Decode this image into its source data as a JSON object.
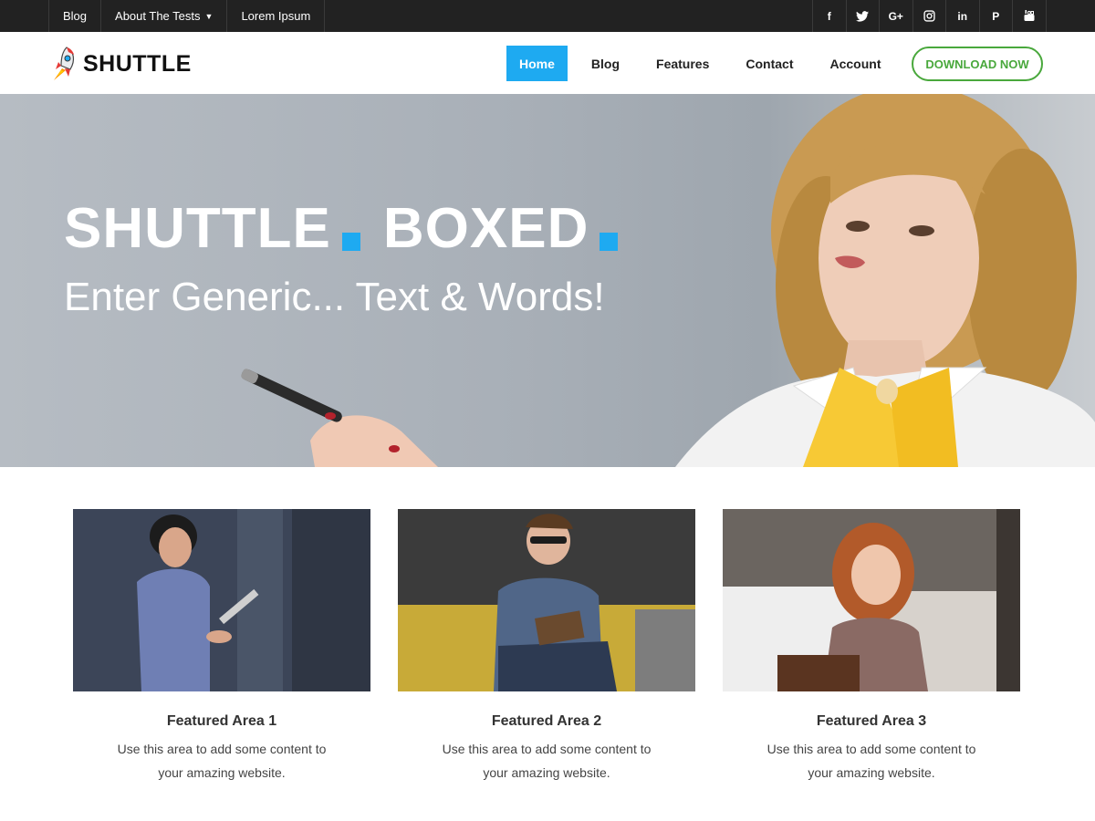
{
  "topbar": {
    "links": [
      "Blog",
      "About The Tests",
      "Lorem Ipsum"
    ],
    "social": [
      {
        "icon": "facebook-icon",
        "glyph": "f"
      },
      {
        "icon": "twitter-icon",
        "glyph": "t"
      },
      {
        "icon": "google-plus-icon",
        "glyph": "G+"
      },
      {
        "icon": "instagram-icon",
        "glyph": "◎"
      },
      {
        "icon": "linkedin-icon",
        "glyph": "in"
      },
      {
        "icon": "paypal-icon",
        "glyph": "P"
      },
      {
        "icon": "youtube-icon",
        "glyph": "▶"
      }
    ]
  },
  "header": {
    "logo_text": "SHUTTLE",
    "nav": [
      "Home",
      "Blog",
      "Features",
      "Contact",
      "Account"
    ],
    "active_nav": "Home",
    "download_label": "DOWNLOAD NOW",
    "colors": {
      "accent": "#1eaaf1",
      "download": "#49a83c"
    }
  },
  "hero": {
    "title_part1": "SHUTTLE",
    "title_part2": "BOXED",
    "subtitle": "Enter Generic... Text & Words!"
  },
  "features": [
    {
      "title": "Featured Area 1",
      "text": "Use this area to add some content to your amazing website."
    },
    {
      "title": "Featured Area 2",
      "text": "Use this area to add some content to your amazing website."
    },
    {
      "title": "Featured Area 3",
      "text": "Use this area to add some content to your amazing website."
    }
  ]
}
